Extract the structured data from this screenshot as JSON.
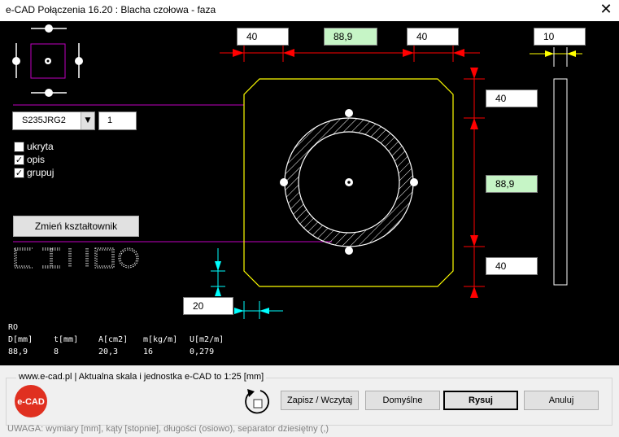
{
  "window": {
    "title": "e-CAD Połączenia 16.20 : Blacha czołowa - faza",
    "close_glyph": "✕"
  },
  "dimensions": {
    "top_left": "40",
    "top_center": "88,9",
    "top_right": "40",
    "thickness": "10",
    "right_top": "40",
    "right_center": "88,9",
    "right_bottom": "40",
    "chamfer": "20"
  },
  "material": {
    "grade": "S235JRG2",
    "dropdown_glyph": "▼",
    "quantity": "1"
  },
  "options": [
    {
      "label": "ukryta",
      "checked": false,
      "mark": ""
    },
    {
      "label": "opis",
      "checked": true,
      "mark": "✓"
    },
    {
      "label": "grupuj",
      "checked": true,
      "mark": "✓"
    }
  ],
  "change_profile_button": "Zmień kształtownik",
  "profile": {
    "name": "RO",
    "headers": [
      "D[mm]",
      "t[mm]",
      "A[cm2]",
      "m[kg/m]",
      "U[m2/m]"
    ],
    "values": [
      "88,9",
      "8",
      "20,3",
      "16",
      "0,279"
    ]
  },
  "footer": {
    "group_label": "www.e-cad.pl | Aktualna skala i jednostka e-CAD to 1:25 [mm]",
    "logo_text": "e-CAD",
    "save_load_button": "Zapisz / Wczytaj",
    "defaults_button": "Domyślne",
    "draw_button": "Rysuj",
    "cancel_button": "Anuluj",
    "warning": "UWAGA: wymiary [mm], kąty [stopnie], długości (osiowo), separator dziesiętny (,)"
  },
  "colors": {
    "canvas": "#000000",
    "plate_outline": "#ffff00",
    "dimension": "#ff0000",
    "thickness_arrow": "#ffff00",
    "chamfer_dimension": "#00ffff",
    "selector_magenta": "#c000c0",
    "highlight_field": "#c6f5c6",
    "logo_red": "#e03020"
  }
}
